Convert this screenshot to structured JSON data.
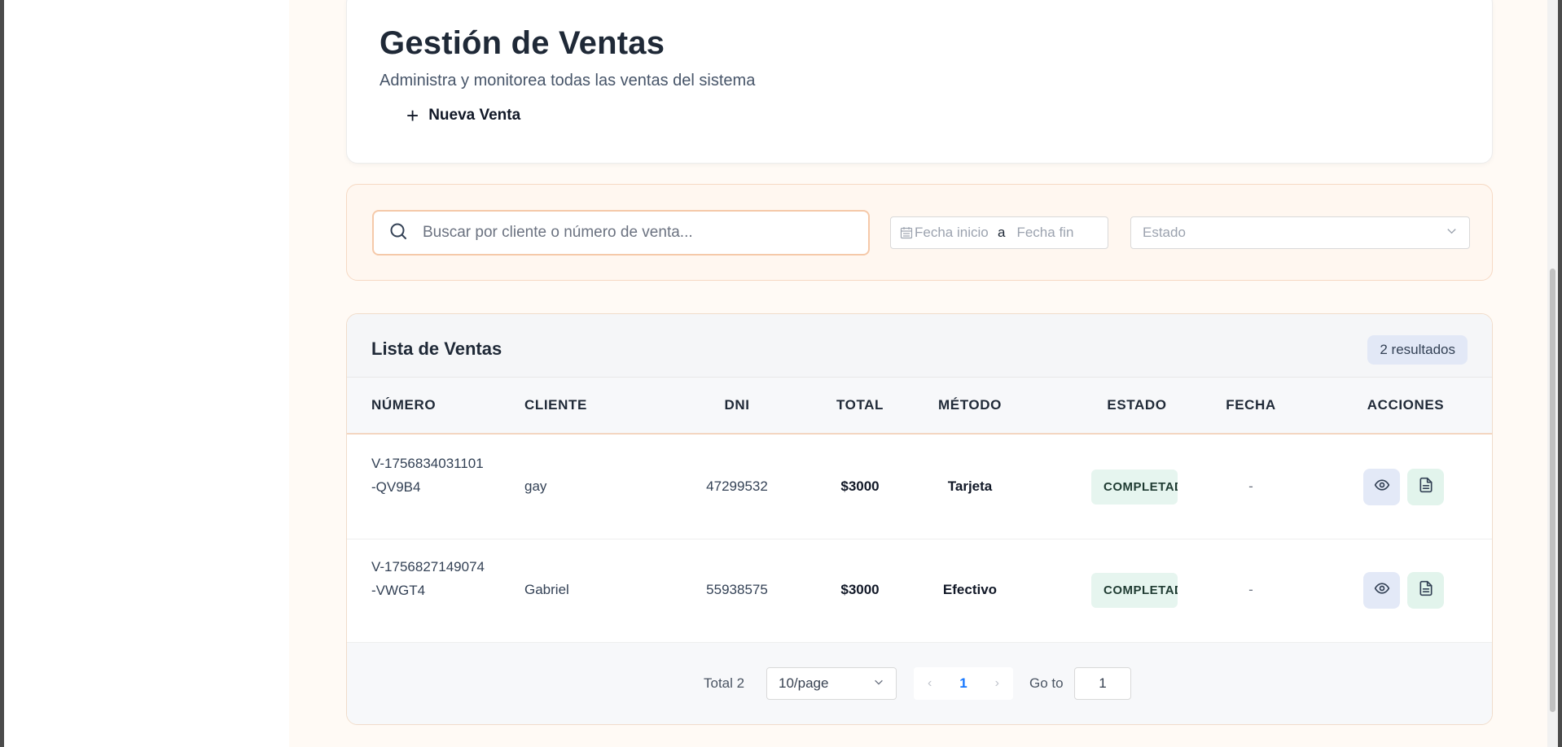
{
  "header": {
    "title": "Gestión de Ventas",
    "subtitle": "Administra y monitorea todas las ventas del sistema",
    "new_sale_label": "Nueva Venta"
  },
  "filters": {
    "search_placeholder": "Buscar por cliente o número de venta...",
    "date_start_placeholder": "Fecha inicio",
    "date_separator": "a",
    "date_end_placeholder": "Fecha fin",
    "state_placeholder": "Estado"
  },
  "list": {
    "title": "Lista de Ventas",
    "count_badge": "2 resultados",
    "columns": [
      "NÚMERO",
      "CLIENTE",
      "DNI",
      "TOTAL",
      "MÉTODO",
      "ESTADO",
      "FECHA",
      "ACCIONES"
    ],
    "rows": [
      {
        "numero": "V-1756834031101-QV9B4",
        "cliente": "gay",
        "dni": "47299532",
        "total": "$3000",
        "metodo": "Tarjeta",
        "estado": "COMPLETADA",
        "fecha": "-"
      },
      {
        "numero": "V-1756827149074-VWGT4",
        "cliente": "Gabriel",
        "dni": "55938575",
        "total": "$3000",
        "metodo": "Efectivo",
        "estado": "COMPLETADA",
        "fecha": "-"
      }
    ]
  },
  "pagination": {
    "total_label": "Total 2",
    "page_size": "10/page",
    "current_page": "1",
    "goto_label": "Go to",
    "goto_value": "1"
  },
  "icons": {
    "search": "search-icon",
    "calendar": "calendar-icon",
    "chevron": "chevron-down-icon",
    "view": "eye-icon",
    "document": "document-icon",
    "plus": "plus-icon"
  },
  "colors": {
    "accent_border": "#f5c9a9",
    "page_background": "#fffaf5",
    "badge_bg": "#e2e8f6",
    "status_bg": "#e6f5ef",
    "pagination_active": "#1677ff"
  }
}
